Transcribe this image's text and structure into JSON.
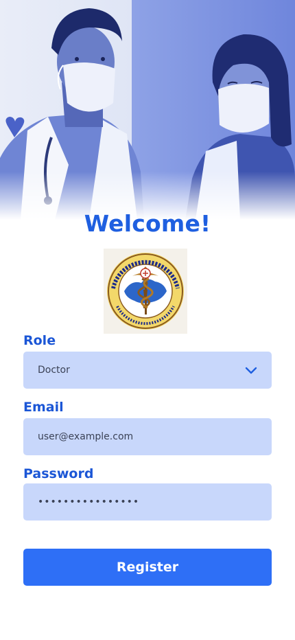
{
  "header": {
    "title": "Welcome!"
  },
  "form": {
    "role": {
      "label": "Role",
      "value": "Doctor"
    },
    "email": {
      "label": "Email",
      "value": "user@example.com"
    },
    "password": {
      "label": "Password",
      "value": "••••••••••••••••"
    }
  },
  "actions": {
    "register_label": "Register"
  },
  "colors": {
    "accent": "#2e6ff6",
    "label": "#1b56d6",
    "field_bg": "#c8d7fb"
  },
  "icons": {
    "role_dropdown": "chevron-down-icon"
  }
}
